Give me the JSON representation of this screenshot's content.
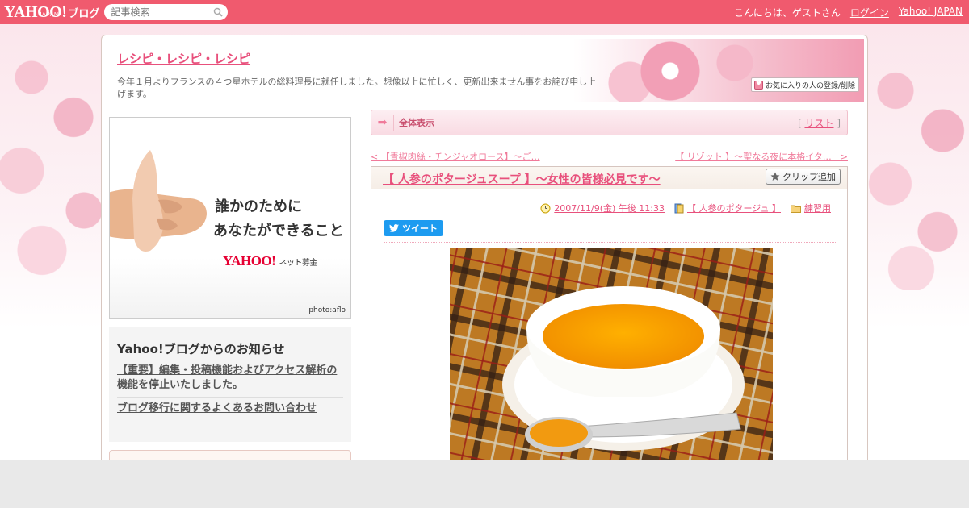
{
  "topbar": {
    "logo_text": "YAHOO!",
    "logo_sub": "JAPAN",
    "blog_label": "ブログ",
    "search_placeholder": "記事検索",
    "greeting": "こんにちは、ゲストさん",
    "login_label": "ログイン",
    "yahoo_japan_label": "Yahoo! JAPAN"
  },
  "blog": {
    "title": "レシピ・レシピ・レシピ",
    "description": "今年１月よりフランスの４つ星ホテルの総料理長に就任しました。想像以上に忙しく、更新出来ません事をお詫び申し上げます。",
    "favorite_label": "お気に入りの人の登録/削除"
  },
  "banner": {
    "line1": "誰かのために",
    "line2": "あなたができること",
    "logo": "YAHOO!",
    "logo_sub": "ネット募金",
    "photo_credit": "photo:aflo"
  },
  "notice": {
    "title": "Yahoo!ブログからのお知らせ",
    "items": [
      "【重要】編集・投稿機能およびアクセス解析の機能を停止いたしました。",
      "ブログ移行に関するよくあるお問い合わせ"
    ]
  },
  "viewbar": {
    "title": "全体表示",
    "bracket_open": "[",
    "list_label": "リスト",
    "bracket_close": "]"
  },
  "navigation": {
    "prev": "< 【青椒肉絲・チンジャオロース】～ご…",
    "next": "【 リゾット 】～聖なる夜に本格イタ…　>"
  },
  "article": {
    "title": "【 人参のポタージュスープ 】～女性の皆様必見です～",
    "clip_label": "クリップ追加",
    "date": "2007/11/9(金) 午後 11:33",
    "tag": "【 人参のポタージュ 】",
    "category": "練習用",
    "tweet_label": "ツイート"
  },
  "colors": {
    "topbar": "#f05a6e",
    "accent": "#e8507c",
    "tweet": "#1d9bf0"
  }
}
